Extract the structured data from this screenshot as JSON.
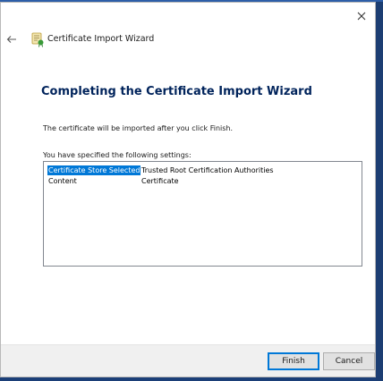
{
  "window": {
    "title": "Certificate Import Wizard",
    "close_glyph": "✕",
    "back_glyph": "←"
  },
  "content": {
    "heading": "Completing the Certificate Import Wizard",
    "info": "The certificate will be imported after you click Finish.",
    "settings_label": "You have specified the following settings:",
    "settings": [
      {
        "key": "Certificate Store Selected",
        "value": "Trusted Root Certification Authorities",
        "selected": true
      },
      {
        "key": "Content",
        "value": "Certificate",
        "selected": false
      }
    ]
  },
  "buttons": {
    "finish": "Finish",
    "cancel": "Cancel"
  },
  "icons": {
    "close": "close-icon",
    "back": "back-arrow-icon",
    "wizard": "certificate-icon"
  },
  "colors": {
    "heading": "#00235b",
    "selection": "#0078d7",
    "desktop": "#1b3f78"
  }
}
